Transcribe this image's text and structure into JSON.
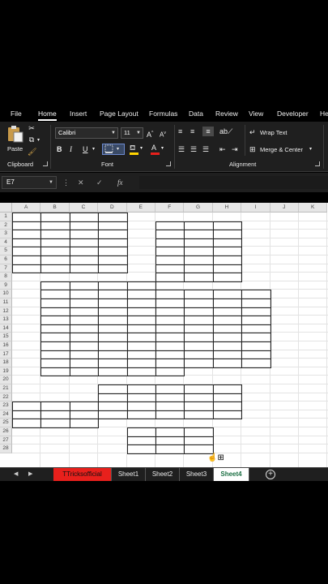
{
  "menu": {
    "tabs": [
      "File",
      "Home",
      "Insert",
      "Page Layout",
      "Formulas",
      "Data",
      "Review",
      "View",
      "Developer",
      "He"
    ],
    "active_tab": "Home"
  },
  "ribbon": {
    "clipboard": {
      "paste_label": "Paste",
      "group_label": "Clipboard"
    },
    "font": {
      "font_name": "Calibri",
      "font_size": "11",
      "group_label": "Font",
      "fill_color": "#ffd400",
      "font_color": "#e8201c"
    },
    "alignment": {
      "wrap_text": "Wrap Text",
      "merge_center": "Merge & Center",
      "group_label": "Alignment"
    }
  },
  "formula_bar": {
    "name_box": "E7",
    "fx": "fx",
    "formula": ""
  },
  "grid": {
    "columns": [
      "A",
      "B",
      "C",
      "D",
      "E",
      "F",
      "G",
      "H",
      "I",
      "J",
      "K"
    ],
    "rows": [
      "1",
      "2",
      "3",
      "4",
      "5",
      "6",
      "7",
      "8",
      "9",
      "10",
      "11",
      "12",
      "13",
      "14",
      "15",
      "16",
      "17",
      "18",
      "19",
      "20",
      "21",
      "22",
      "23",
      "24",
      "25",
      "26",
      "27",
      "28"
    ]
  },
  "sheets": {
    "tabs": [
      "TTricksofficial",
      "Sheet1",
      "Sheet2",
      "Sheet3",
      "Sheet4"
    ],
    "active": "Sheet4",
    "highlight_color": "#e8201c"
  }
}
